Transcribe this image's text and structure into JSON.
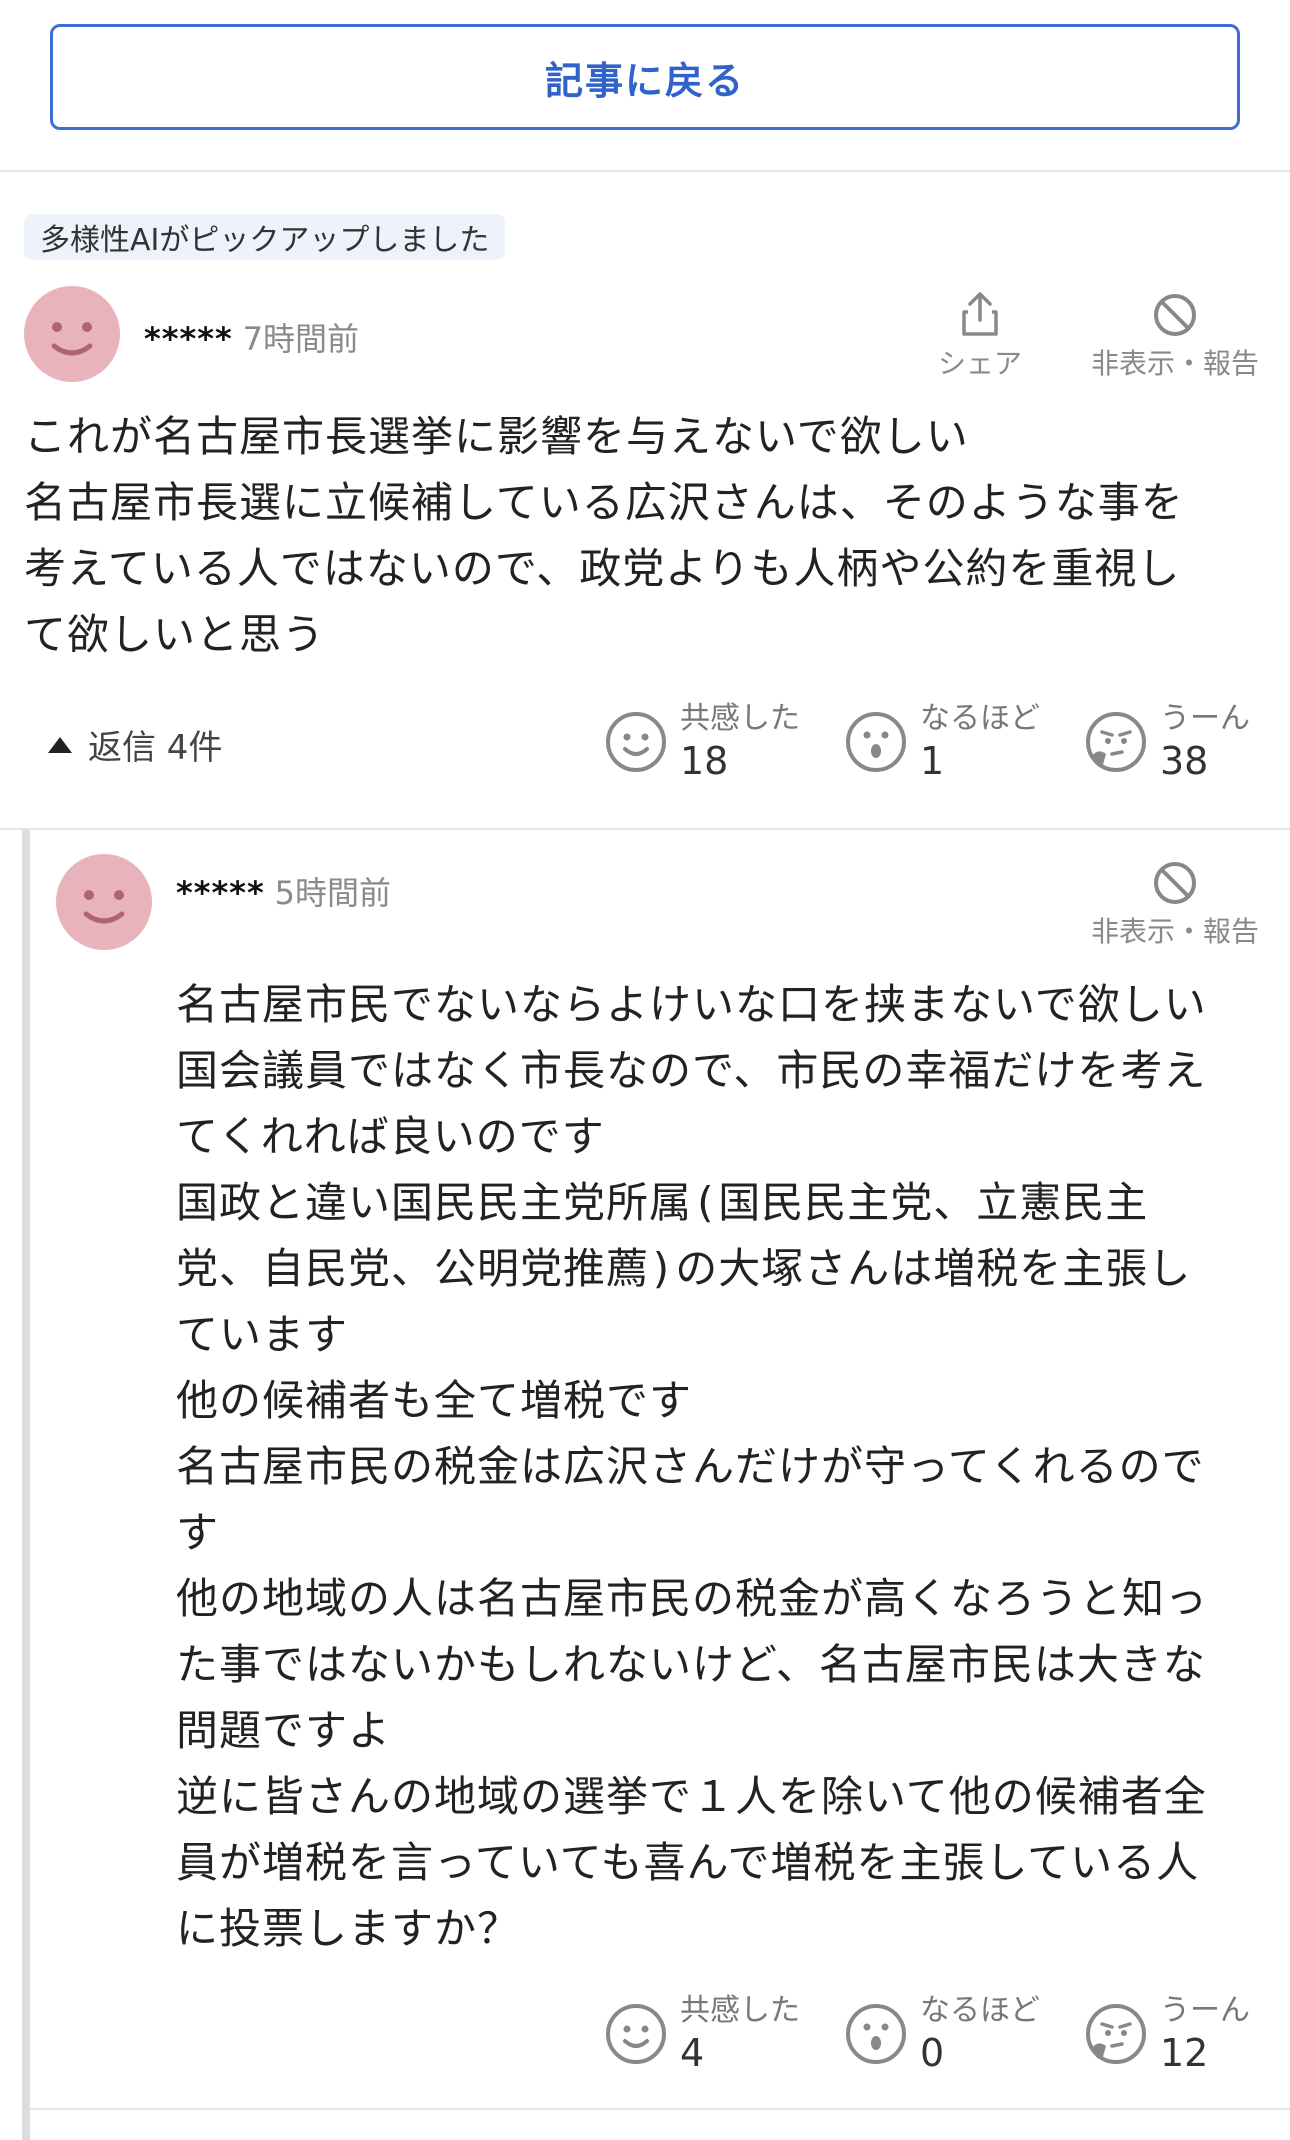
{
  "back_button": {
    "label": "記事に戻る"
  },
  "ai_badge": {
    "label": "多様性AIがピックアップしました"
  },
  "comment": {
    "user": "*****",
    "time": "7時間前",
    "share_label": "シェア",
    "report_label": "非表示・報告",
    "body": "これが名古屋市長選挙に影響を与えないで欲しい\n名古屋市長選に立候補している広沢さんは、そのような事を\n考えている人ではないので、政党よりも人柄や公約を重視し\nて欲しいと思う",
    "replies_label": "返信 4件",
    "reactions": {
      "empathy": {
        "label": "共感した",
        "count": "18"
      },
      "naruhodo": {
        "label": "なるほど",
        "count": "1"
      },
      "uun": {
        "label": "うーん",
        "count": "38"
      }
    }
  },
  "reply": {
    "user": "*****",
    "time": "5時間前",
    "report_label": "非表示・報告",
    "body": "名古屋市民でないならよけいな口を挟まないで欲しい\n国会議員ではなく市長なので、市民の幸福だけを考え\nてくれれば良いのです\n国政と違い国民民主党所属(国民民主党、立憲民主\n党、自民党、公明党推薦)の大塚さんは増税を主張し\nています\n他の候補者も全て増税です\n名古屋市民の税金は広沢さんだけが守ってくれるので\nす\n他の地域の人は名古屋市民の税金が高くなろうと知っ\nた事ではないかもしれないけど、名古屋市民は大きな\n問題ですよ\n逆に皆さんの地域の選挙で１人を除いて他の候補者全\n員が増税を言っていても喜んで増税を主張している人\nに投票しますか？",
    "reactions": {
      "empathy": {
        "label": "共感した",
        "count": "4"
      },
      "naruhodo": {
        "label": "なるほど",
        "count": "0"
      },
      "uun": {
        "label": "うーん",
        "count": "12"
      }
    }
  },
  "colors": {
    "accent": "#2f63c9",
    "avatar": "#e9b3bb",
    "muted": "#8a8a8a"
  }
}
